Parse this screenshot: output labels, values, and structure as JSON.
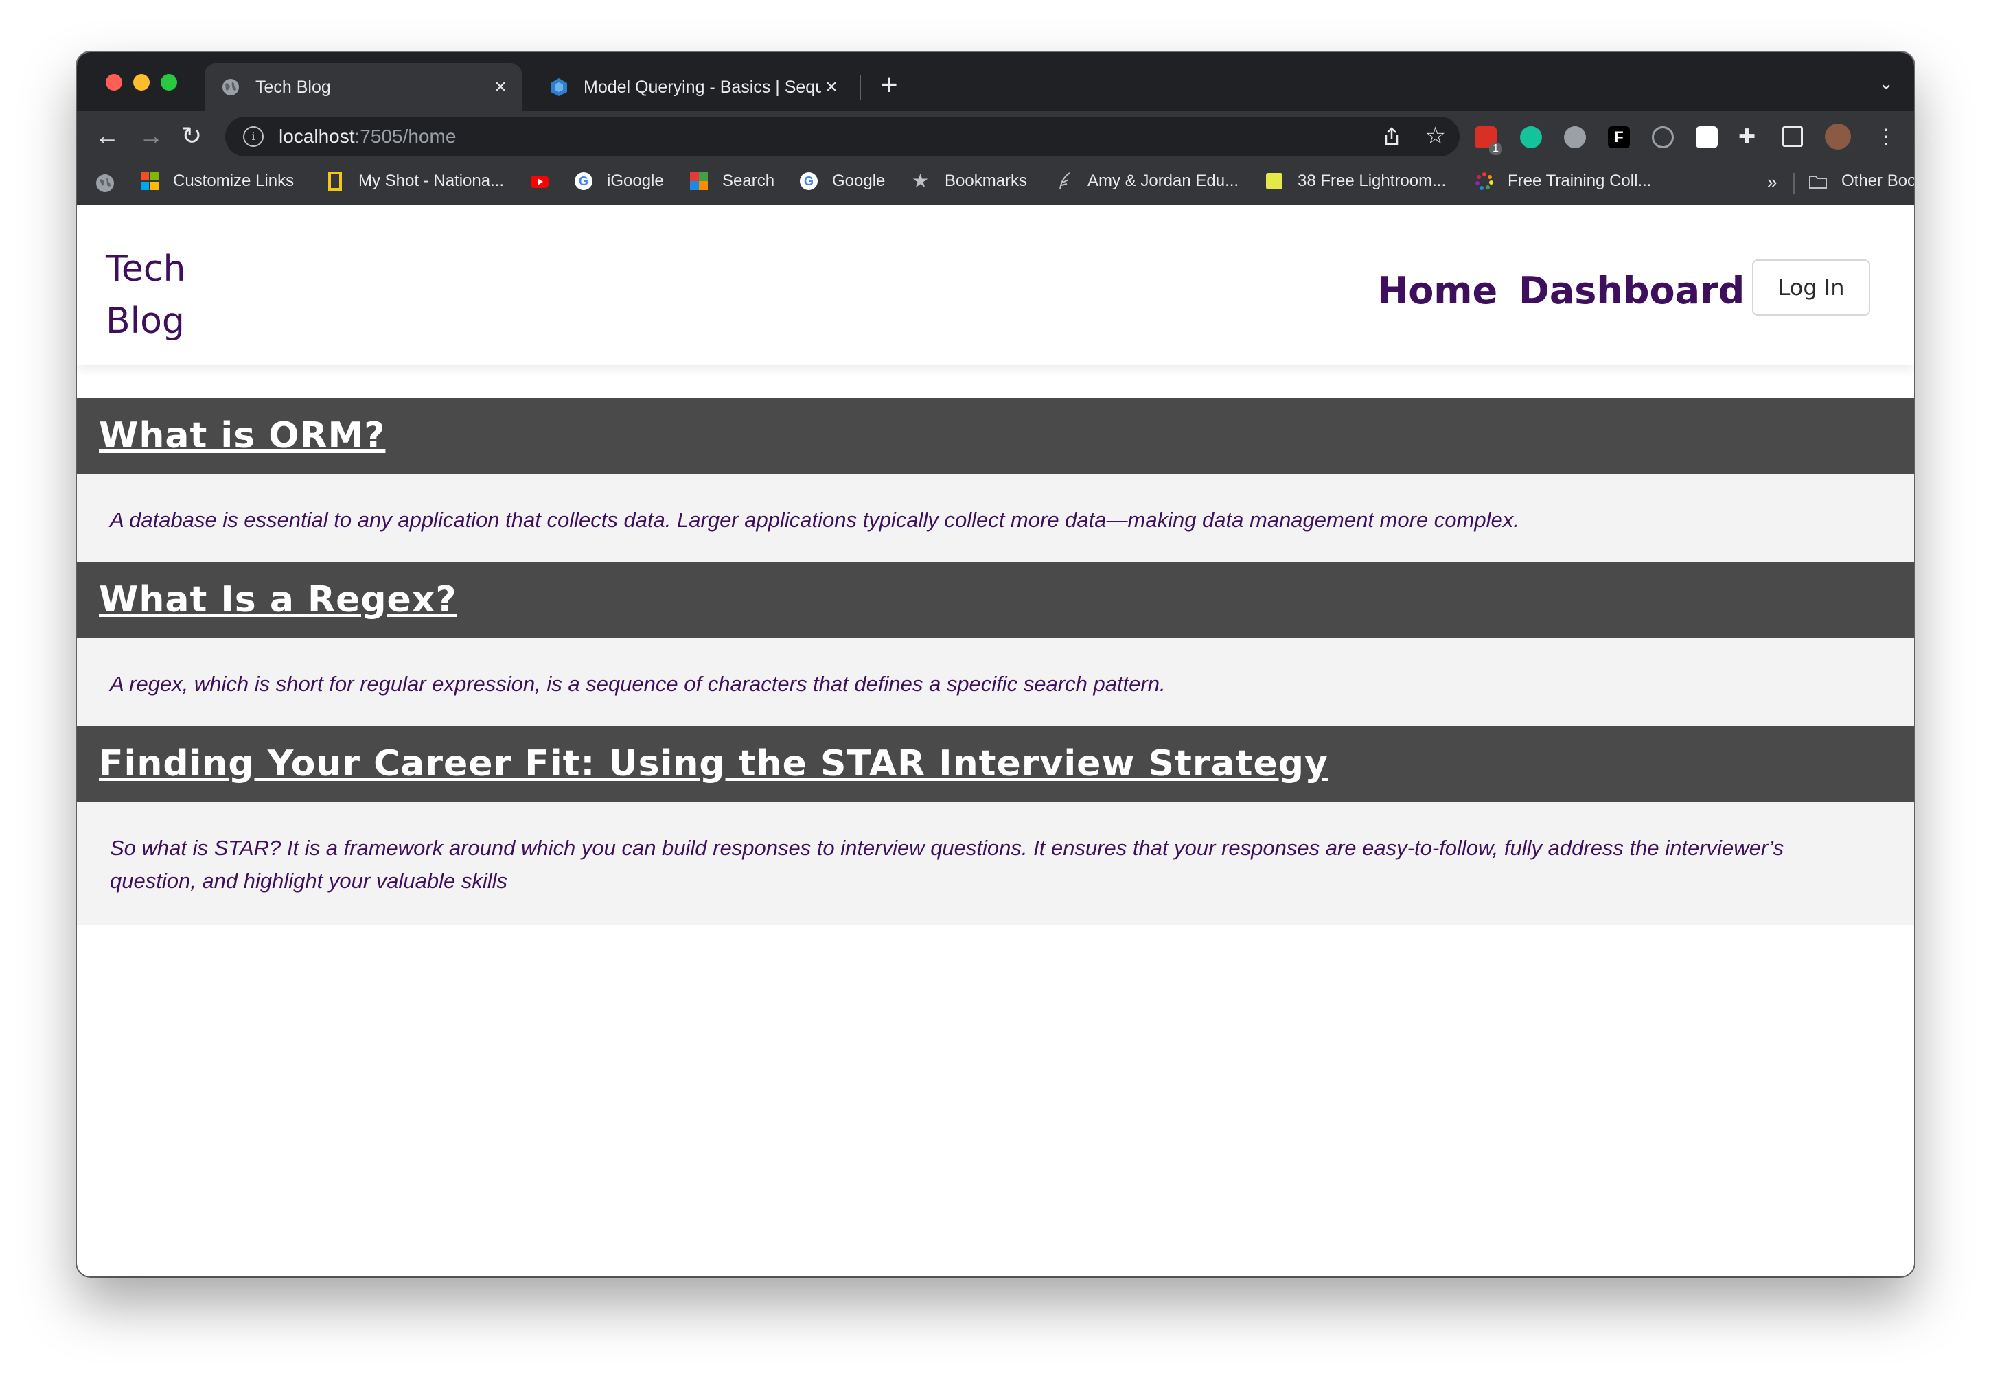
{
  "browser": {
    "tabs": [
      {
        "title": "Tech Blog",
        "active": true
      },
      {
        "title": "Model Querying - Basics | Sequelize",
        "active": false
      }
    ],
    "address": {
      "host": "localhost",
      "path": ":7505/home"
    },
    "bookmarks": [
      {
        "label": "Customize Links"
      },
      {
        "label": "My Shot - Nationa..."
      },
      {
        "label": "iGoogle"
      },
      {
        "label": "Search"
      },
      {
        "label": "Google"
      },
      {
        "label": "Bookmarks"
      },
      {
        "label": "Amy & Jordan Edu..."
      },
      {
        "label": "38 Free Lightroom..."
      },
      {
        "label": "Free Training Coll..."
      }
    ],
    "overflow": "»",
    "other_bookmarks": "Other Bookmarks",
    "extension_badge": "1"
  },
  "site": {
    "brand": "Tech Blog",
    "nav": {
      "home": "Home",
      "dashboard": "Dashboard",
      "login": "Log In"
    },
    "posts": [
      {
        "title": "What is ORM?",
        "body": "A database is essential to any application that collects data. Larger applications typically collect more data—making data management more complex."
      },
      {
        "title": "What Is a Regex?",
        "body": "A regex, which is short for regular expression, is a sequence of characters that defines a specific search pattern."
      },
      {
        "title": "Finding Your Career Fit: Using the STAR Interview Strategy",
        "body": "So what is STAR? It is a framework around which you can build responses to interview questions. It ensures that your responses are easy-to-follow, fully address the interviewer’s question, and highlight your valuable skills"
      }
    ]
  },
  "colors": {
    "brand": "#3d0f5c",
    "post_header": "#4a4a4a",
    "post_body_bg": "#f3f3f3"
  }
}
